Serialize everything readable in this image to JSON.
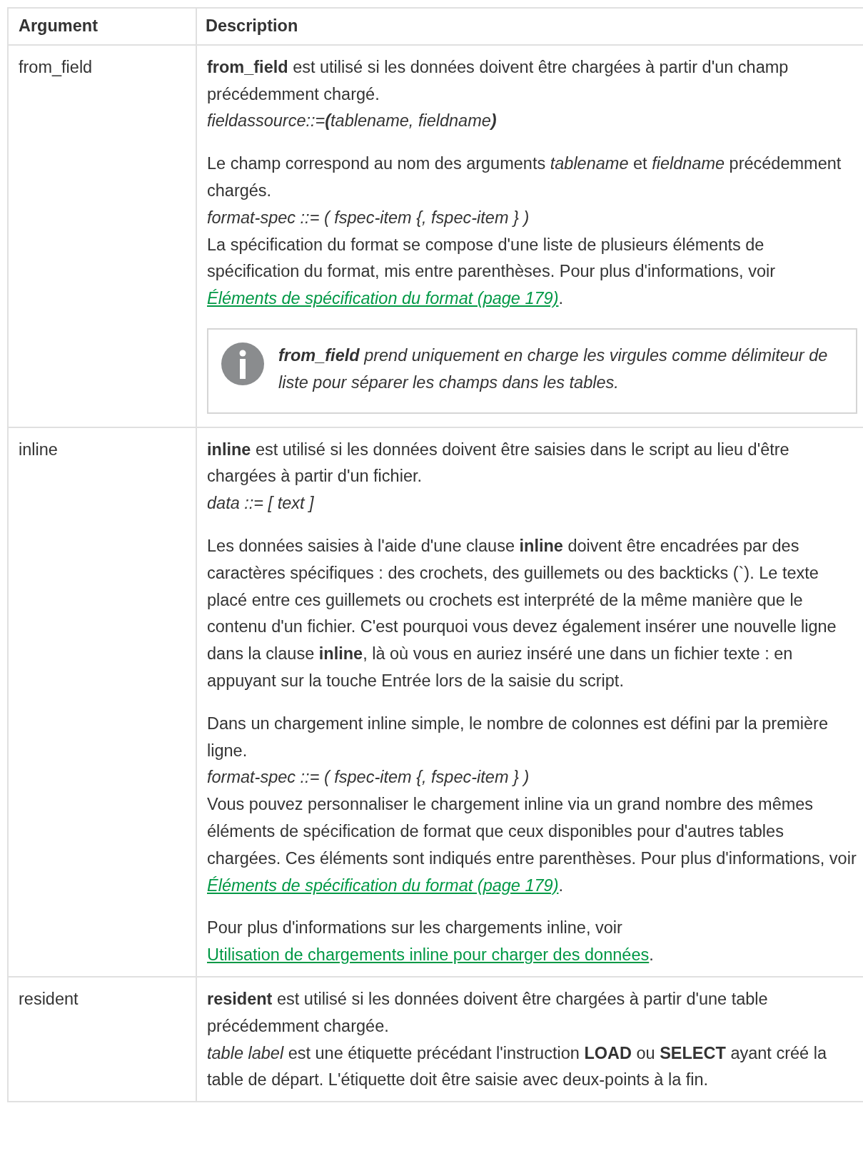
{
  "table": {
    "columns": [
      "Argument",
      "Description"
    ],
    "rows": [
      {
        "argument": "from_field",
        "paragraphs": [
          {
            "kind": "text",
            "lines": [
              {
                "kind": "sentence",
                "text": "**from_field** est utilisé si les données doivent être chargées à partir d'un champ précédemment chargé."
              },
              {
                "kind": "syntax",
                "text": "fieldassource::=**(**tablename, fieldname**)**"
              }
            ]
          },
          {
            "kind": "text",
            "lines": [
              {
                "kind": "sentence",
                "text": "Le champ correspond au nom des arguments *tablename* et *fieldname* précédemment chargés."
              },
              {
                "kind": "syntax",
                "text": "format-spec ::= ( fspec-item {, fspec-item } )"
              },
              {
                "kind": "sentence",
                "text": "La spécification du format se compose d'une liste de plusieurs éléments de spécification du format, mis entre parenthèses. Pour plus d'informations, voir ",
                "link": {
                  "kind": "page-reference",
                  "text": "Éléments de spécification du format (page 179)"
                },
                "after": "."
              }
            ]
          },
          {
            "kind": "note",
            "text": "**from_field** prend uniquement en charge les virgules comme délimiteur de liste pour séparer les champs dans les tables."
          }
        ]
      },
      {
        "argument": "inline",
        "paragraphs": [
          {
            "kind": "text",
            "lines": [
              {
                "kind": "sentence",
                "text": "**inline** est utilisé si les données doivent être saisies dans le script au lieu d'être chargées à partir d'un fichier."
              },
              {
                "kind": "syntax",
                "text": "data ::= [ text ]"
              }
            ]
          },
          {
            "kind": "text",
            "lines": [
              {
                "kind": "sentence",
                "text": "Les données saisies à l'aide d'une clause **inline** doivent être encadrées par des caractères spécifiques : des crochets, des guillemets ou des backticks (`). Le texte placé entre ces guillemets ou crochets est interprété de la même manière que le contenu d'un fichier. C'est pourquoi vous devez également insérer une nouvelle ligne dans la clause **inline**, là où vous en auriez inséré une dans un fichier texte : en appuyant sur la touche Entrée lors de la saisie du script."
              }
            ]
          },
          {
            "kind": "text",
            "lines": [
              {
                "kind": "sentence",
                "text": "Dans un chargement inline simple, le nombre de colonnes est défini par la première ligne."
              },
              {
                "kind": "syntax",
                "text": "format-spec ::= ( fspec-item {, fspec-item } )"
              },
              {
                "kind": "sentence",
                "text": "Vous pouvez personnaliser le chargement inline via un grand nombre des mêmes éléments de spécification de format que ceux disponibles pour d'autres tables chargées. Ces éléments sont indiqués entre parenthèses. Pour plus d'informations, voir ",
                "link": {
                  "kind": "page-reference",
                  "text": "Éléments de spécification du format (page 179)"
                },
                "after": "."
              }
            ]
          },
          {
            "kind": "text",
            "lines": [
              {
                "kind": "sentence",
                "text": "Pour plus d'informations sur les chargements inline, voir ",
                "link": {
                  "kind": "topic",
                  "text": "Utilisation de chargements inline pour charger des données"
                },
                "after": "."
              }
            ]
          }
        ]
      },
      {
        "argument": "resident",
        "paragraphs": [
          {
            "kind": "text",
            "lines": [
              {
                "kind": "sentence",
                "text": "**resident** est utilisé si les données doivent être chargées à partir d'une table précédemment chargée."
              },
              {
                "kind": "sentence",
                "text": "*table label* est une étiquette précédant l'instruction **LOAD** ou **SELECT** ayant créé la table de départ. L'étiquette doit être saisie avec deux-points à la fin."
              }
            ]
          }
        ]
      }
    ]
  }
}
